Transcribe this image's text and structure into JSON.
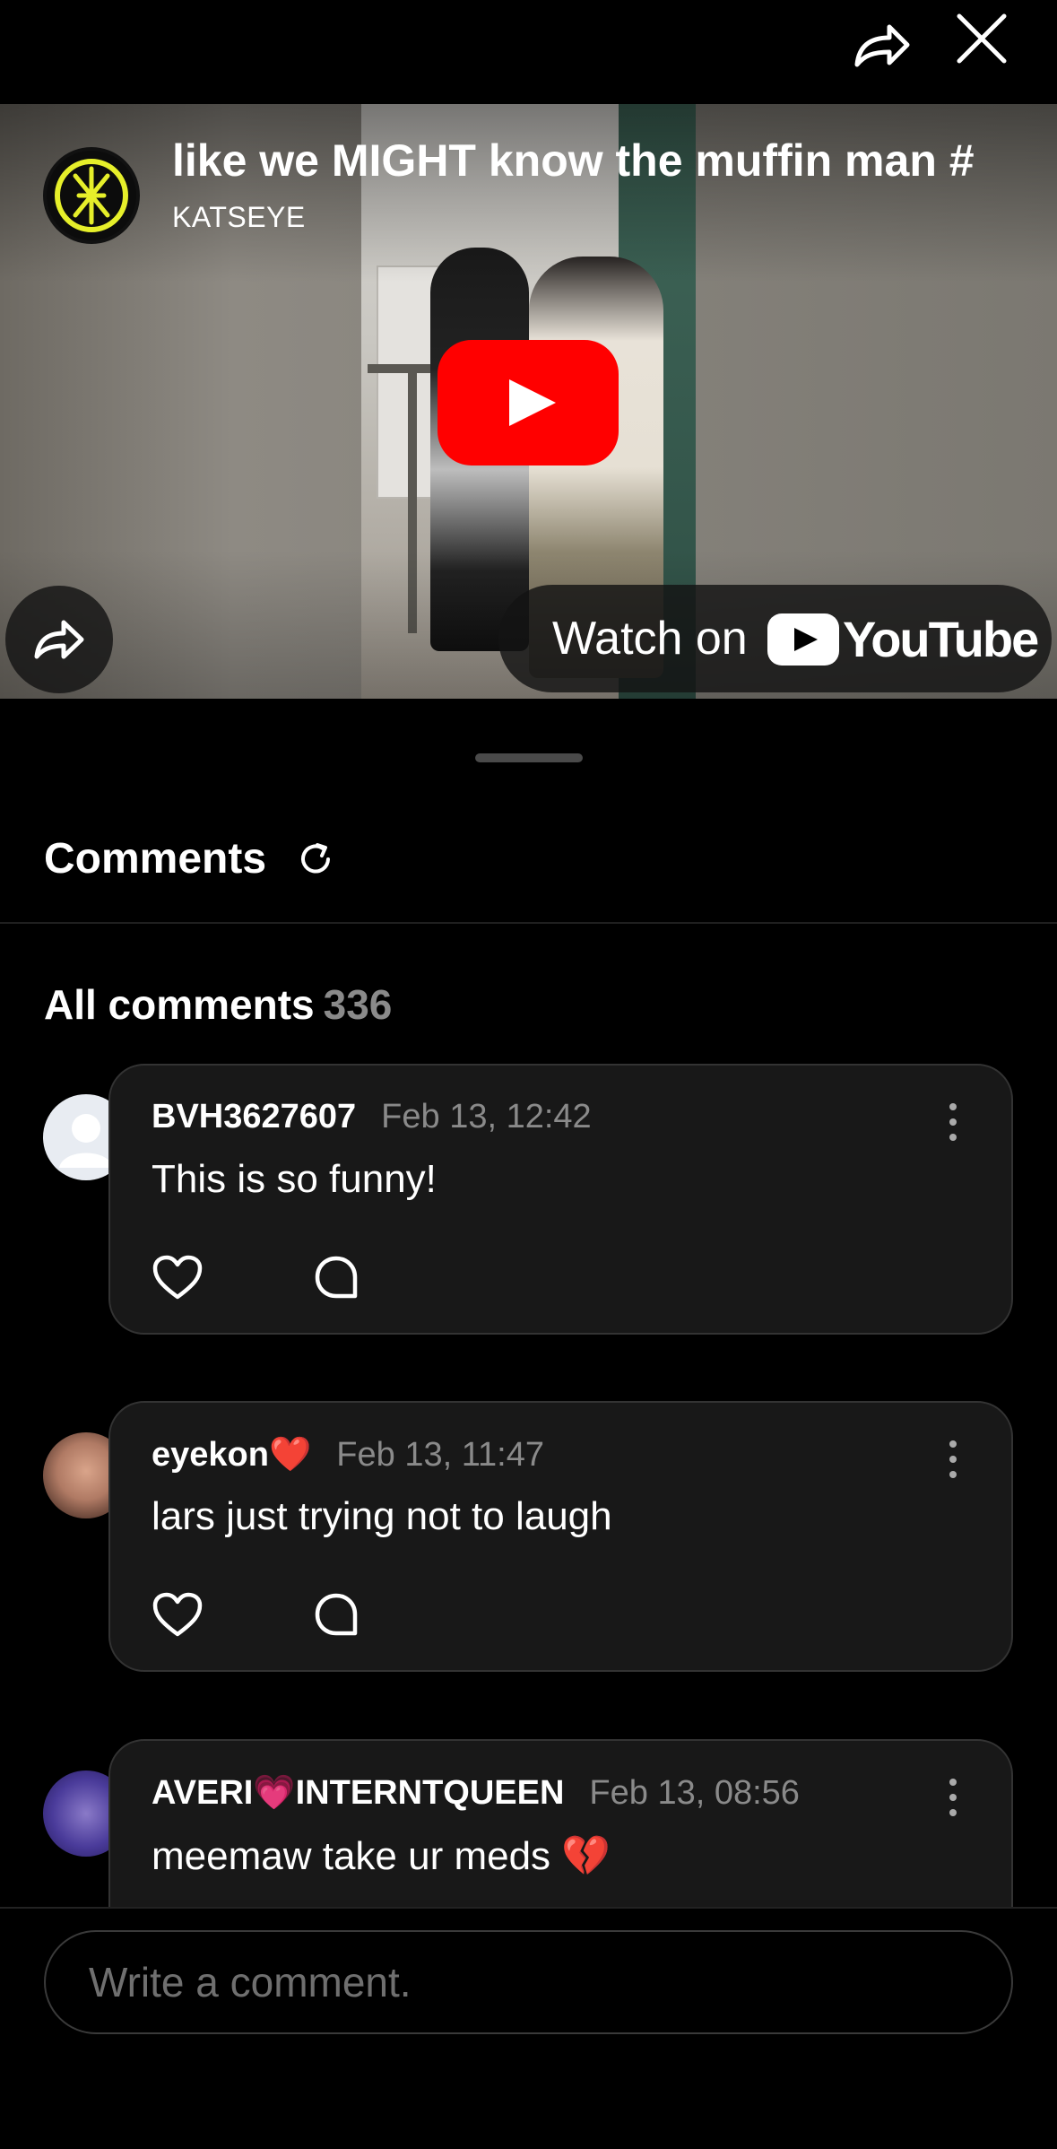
{
  "video": {
    "title": "like we MIGHT know the muffin man #",
    "channel": "KATSEYE",
    "watch_on": "Watch on",
    "youtube_word": "YouTube"
  },
  "comments": {
    "title": "Comments",
    "all_label": "All comments",
    "count": "336",
    "items": [
      {
        "author": "BVH3627607",
        "time": "Feb 13, 12:42",
        "text": "This is so funny!"
      },
      {
        "author": "eyekon❤️",
        "time": "Feb 13, 11:47",
        "text": "lars just trying not to laugh"
      },
      {
        "author": "AVERI💗INTERNTQUEEN",
        "time": "Feb 13, 08:56",
        "text": "meemaw take ur meds 💔"
      }
    ]
  },
  "composer": {
    "placeholder": "Write a comment."
  },
  "icons": [
    "share-icon",
    "close-icon",
    "play-icon",
    "refresh-icon",
    "more-icon",
    "heart-icon",
    "reply-icon"
  ],
  "colors": {
    "youtube_red": "#ff0000",
    "background": "#000000",
    "card": "#181818",
    "muted": "#8a8a8a"
  }
}
